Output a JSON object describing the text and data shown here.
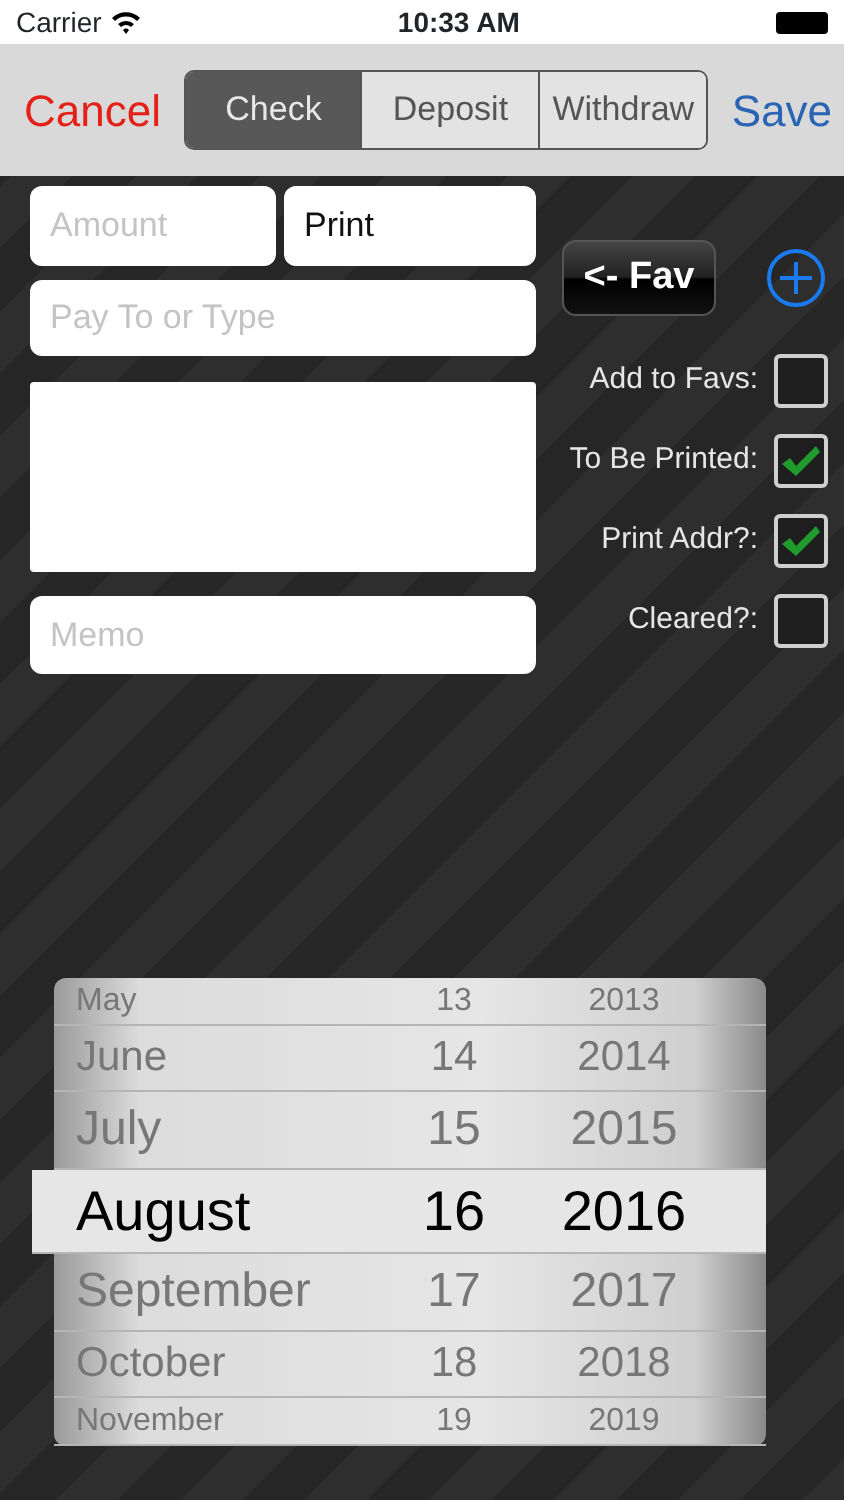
{
  "status_bar": {
    "carrier": "Carrier",
    "time": "10:33 AM"
  },
  "nav": {
    "cancel": "Cancel",
    "save": "Save",
    "segments": [
      {
        "label": "Check",
        "selected": true
      },
      {
        "label": "Deposit",
        "selected": false
      },
      {
        "label": "Withdraw",
        "selected": false
      }
    ]
  },
  "form": {
    "amount": {
      "placeholder": "Amount"
    },
    "check_number": {
      "value": "Print"
    },
    "payee": {
      "placeholder": "Pay To or Type"
    },
    "memo": {
      "placeholder": "Memo"
    }
  },
  "fav_button": "<- Fav",
  "options": [
    {
      "label": "Add to Favs:",
      "checked": false
    },
    {
      "label": "To Be Printed:",
      "checked": true
    },
    {
      "label": "Print Addr?:",
      "checked": true
    },
    {
      "label": "Cleared?:",
      "checked": false
    }
  ],
  "date_picker": {
    "rows": [
      {
        "month": "May",
        "day": "13",
        "year": "2013",
        "selected": false
      },
      {
        "month": "June",
        "day": "14",
        "year": "2014",
        "selected": false
      },
      {
        "month": "July",
        "day": "15",
        "year": "2015",
        "selected": false
      },
      {
        "month": "August",
        "day": "16",
        "year": "2016",
        "selected": true
      },
      {
        "month": "September",
        "day": "17",
        "year": "2017",
        "selected": false
      },
      {
        "month": "October",
        "day": "18",
        "year": "2018",
        "selected": false
      },
      {
        "month": "November",
        "day": "19",
        "year": "2019",
        "selected": false
      }
    ]
  }
}
